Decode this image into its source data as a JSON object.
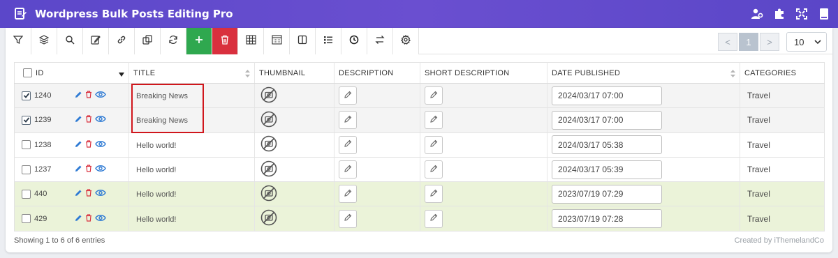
{
  "app": {
    "title": "Wordpress Bulk Posts Editing Pro"
  },
  "header_icons": [
    "user-settings-icon",
    "plugin-puzzle-icon",
    "fullscreen-icon",
    "book-icon"
  ],
  "toolbar": {
    "buttons": [
      "filter-icon",
      "layers-icon",
      "search-icon",
      "edit-icon",
      "link-icon",
      "duplicate-icon",
      "refresh-icon",
      "add-icon",
      "trash-icon",
      "table-icon",
      "column-grid-icon",
      "split-view-icon",
      "list-icon",
      "history-icon",
      "swap-icon",
      "settings-icon"
    ]
  },
  "pagination": {
    "prev": "<",
    "current": "1",
    "next": ">",
    "per_page": "10"
  },
  "table": {
    "columns": {
      "id": "ID",
      "title": "TITLE",
      "thumbnail": "THUMBNAIL",
      "description": "DESCRIPTION",
      "short_description": "SHORT DESCRIPTION",
      "date_published": "DATE PUBLISHED",
      "categories": "CATEGORIES"
    },
    "rows": [
      {
        "id": "1240",
        "checked": true,
        "title": "Breaking News",
        "date": "2024/03/17 07:00",
        "category": "Travel",
        "style": "grey"
      },
      {
        "id": "1239",
        "checked": true,
        "title": "Breaking News",
        "date": "2024/03/17 07:00",
        "category": "Travel",
        "style": "grey"
      },
      {
        "id": "1238",
        "checked": false,
        "title": "Hello world!",
        "date": "2024/03/17 05:38",
        "category": "Travel",
        "style": "white"
      },
      {
        "id": "1237",
        "checked": false,
        "title": "Hello world!",
        "date": "2024/03/17 05:39",
        "category": "Travel",
        "style": "white"
      },
      {
        "id": "440",
        "checked": false,
        "title": "Hello world!",
        "date": "2023/07/19 07:29",
        "category": "Travel",
        "style": "green"
      },
      {
        "id": "429",
        "checked": false,
        "title": "Hello world!",
        "date": "2023/07/19 07:28",
        "category": "Travel",
        "style": "green"
      }
    ]
  },
  "footer": {
    "summary": "Showing 1 to 6 of 6 entries",
    "credit": "Created by iThemelandCo"
  },
  "colors": {
    "header": "#5b47c9",
    "add": "#2fa84f",
    "delete": "#d9303e",
    "highlight": "#d0161c",
    "green_row": "#ebf3d9"
  }
}
